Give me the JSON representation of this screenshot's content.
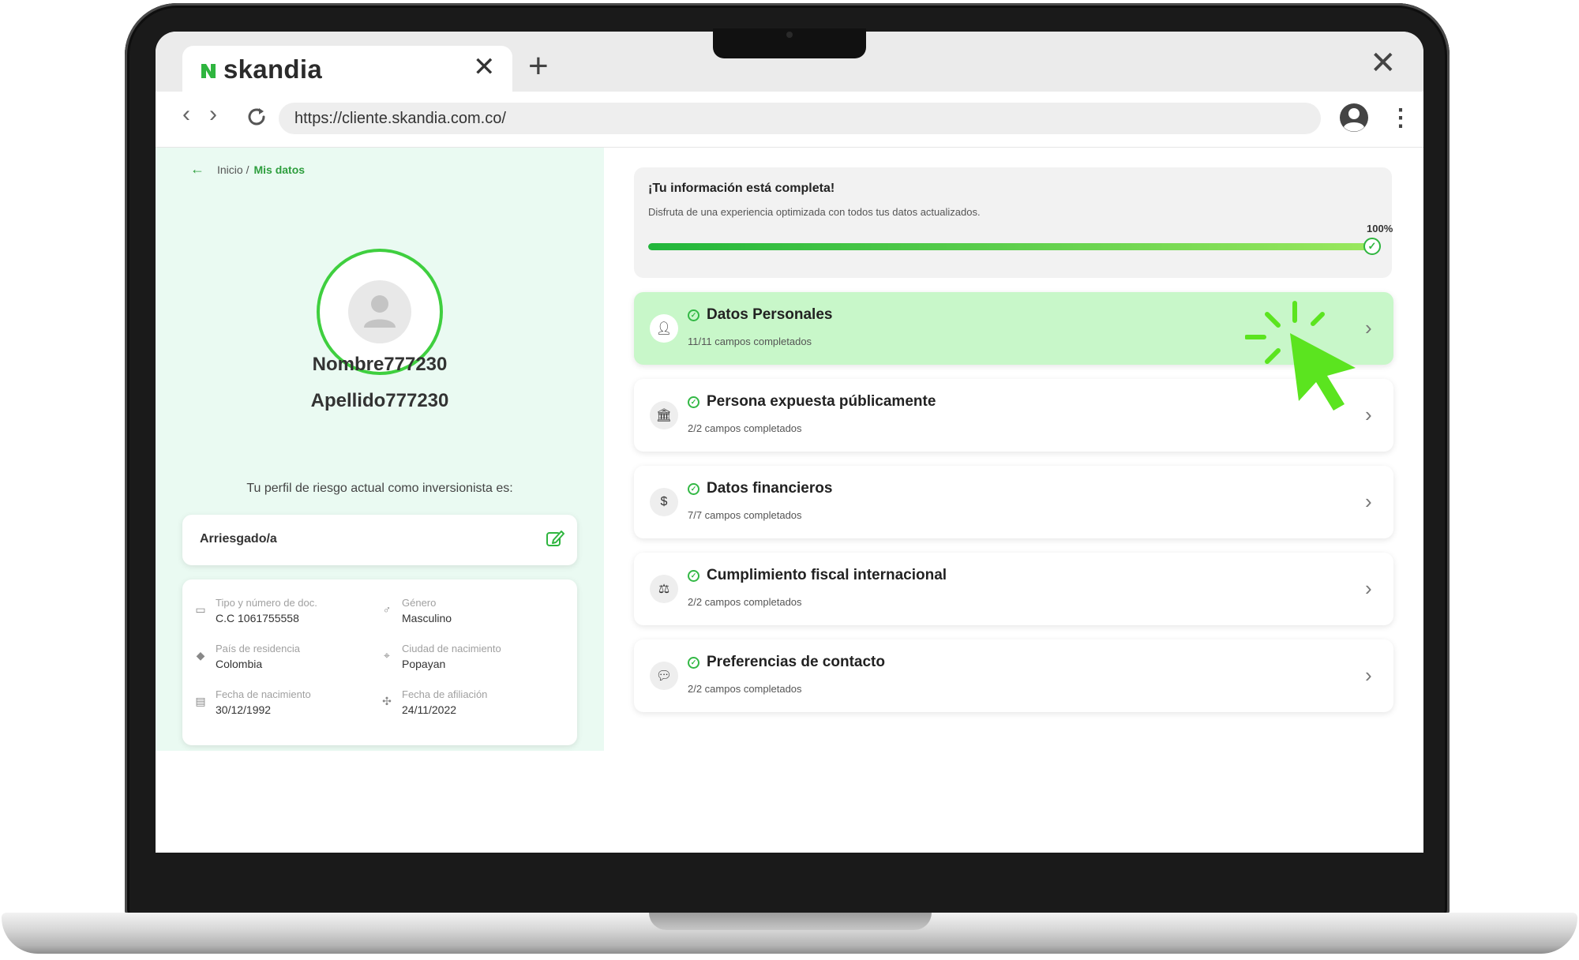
{
  "browser": {
    "tab_title": "skandia",
    "url": "https://cliente.skandia.com.co/",
    "new_tab_symbol": "+",
    "close_symbol": "✕"
  },
  "breadcrumb": {
    "home": "Inicio /",
    "current": "Mis datos"
  },
  "profile": {
    "first_name": "Nombre777230",
    "last_name": "Apellido777230",
    "risk_caption": "Tu perfil de riesgo actual como inversionista es:",
    "risk_value": "Arriesgado/a"
  },
  "info": [
    {
      "label": "Tipo y número de doc.",
      "value": "C.C 1061755558",
      "icon": "id-card-icon"
    },
    {
      "label": "Género",
      "value": "Masculino",
      "icon": "gender-icon"
    },
    {
      "label": "País de residencia",
      "value": "Colombia",
      "icon": "location-icon"
    },
    {
      "label": "Ciudad de nacimiento",
      "value": "Popayan",
      "icon": "map-pin-icon"
    },
    {
      "label": "Fecha de nacimiento",
      "value": "30/12/1992",
      "icon": "cake-icon"
    },
    {
      "label": "Fecha de afiliación",
      "value": "24/11/2022",
      "icon": "handshake-icon"
    }
  ],
  "completion": {
    "title": "¡Tu información está completa!",
    "subtitle": "Disfruta de una experiencia optimizada con todos tus datos actualizados.",
    "percent_label": "100%",
    "progress": 1.0
  },
  "sections": [
    {
      "title": "Datos Personales",
      "subtitle": "11/11 campos completados",
      "icon": "person-icon",
      "active": true
    },
    {
      "title": "Persona expuesta públicamente",
      "subtitle": "2/2 campos completados",
      "icon": "bank-icon",
      "active": false
    },
    {
      "title": "Datos financieros",
      "subtitle": "7/7 campos completados",
      "icon": "dollar-icon",
      "active": false
    },
    {
      "title": "Cumplimiento fiscal internacional",
      "subtitle": "2/2 campos completados",
      "icon": "scale-icon",
      "active": false
    },
    {
      "title": "Preferencias de contacto",
      "subtitle": "2/2 campos completados",
      "icon": "chat-icon",
      "active": false
    }
  ],
  "colors": {
    "brand_green": "#2fb53f",
    "active_row": "#c8f7c9",
    "left_panel": "#eafaf2",
    "cursor": "#5be41f"
  }
}
